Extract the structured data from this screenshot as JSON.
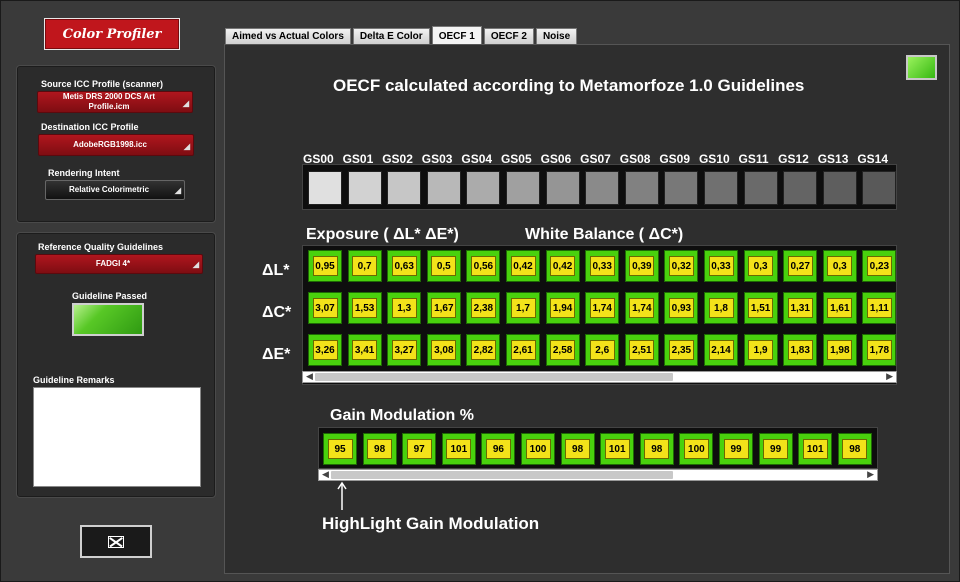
{
  "app": {
    "logo_text": "Color Profiler"
  },
  "sidebar": {
    "source_label": "Source ICC Profile (scanner)",
    "source_value": "Metis DRS 2000 DCS Art Profile.icm",
    "dest_label": "Destination ICC Profile",
    "dest_value": "AdobeRGB1998.icc",
    "intent_label": "Rendering Intent",
    "intent_value": "Relative Colorimetric",
    "guidelines_label": "Reference Quality Guidelines",
    "guidelines_value": "FADGI 4*",
    "passed_label": "Guideline Passed",
    "remarks_label": "Guideline Remarks"
  },
  "tabs": [
    "Aimed vs Actual Colors",
    "Delta E Color",
    "OECF 1",
    "OECF 2",
    "Noise"
  ],
  "active_tab": 2,
  "main": {
    "title": "OECF calculated according to Metamorfoze 1.0 Guidelines",
    "exposure_title": "Exposure ( ΔL*   ΔE*)",
    "wb_title": "White Balance ( ΔC*)",
    "gain_title": "Gain Modulation %",
    "highlight_label": "HighLight Gain Modulation",
    "row_labels": [
      "ΔL*",
      "ΔC*",
      "ΔE*"
    ]
  },
  "gray_patches": [
    {
      "label": "GS00",
      "color": "#e0e0e0"
    },
    {
      "label": "GS01",
      "color": "#d2d2d2"
    },
    {
      "label": "GS02",
      "color": "#c6c6c6"
    },
    {
      "label": "GS03",
      "color": "#b8b8b8"
    },
    {
      "label": "GS04",
      "color": "#ababab"
    },
    {
      "label": "GS05",
      "color": "#a0a0a0"
    },
    {
      "label": "GS06",
      "color": "#959595"
    },
    {
      "label": "GS07",
      "color": "#8a8a8a"
    },
    {
      "label": "GS08",
      "color": "#818181"
    },
    {
      "label": "GS09",
      "color": "#787878"
    },
    {
      "label": "GS10",
      "color": "#707070"
    },
    {
      "label": "GS11",
      "color": "#6a6a6a"
    },
    {
      "label": "GS12",
      "color": "#646464"
    },
    {
      "label": "GS13",
      "color": "#5e5e5e"
    },
    {
      "label": "GS14",
      "color": "#595959"
    }
  ],
  "delta_L": [
    "0,95",
    "0,7",
    "0,63",
    "0,5",
    "0,56",
    "0,42",
    "0,42",
    "0,33",
    "0,39",
    "0,32",
    "0,33",
    "0,3",
    "0,27",
    "0,3",
    "0,23"
  ],
  "delta_C": [
    "3,07",
    "1,53",
    "1,3",
    "1,67",
    "2,38",
    "1,7",
    "1,94",
    "1,74",
    "1,74",
    "0,93",
    "1,8",
    "1,51",
    "1,31",
    "1,61",
    "1,11"
  ],
  "delta_E": [
    "3,26",
    "3,41",
    "3,27",
    "3,08",
    "2,82",
    "2,61",
    "2,58",
    "2,6",
    "2,51",
    "2,35",
    "2,14",
    "1,9",
    "1,83",
    "1,98",
    "1,78"
  ],
  "gain": [
    "95",
    "98",
    "97",
    "101",
    "96",
    "100",
    "98",
    "101",
    "98",
    "100",
    "99",
    "99",
    "101",
    "98"
  ],
  "colors": {
    "cell_green": "#49d10d",
    "cell_yellow": "#f3e21a",
    "logo_red": "#c0161c"
  }
}
